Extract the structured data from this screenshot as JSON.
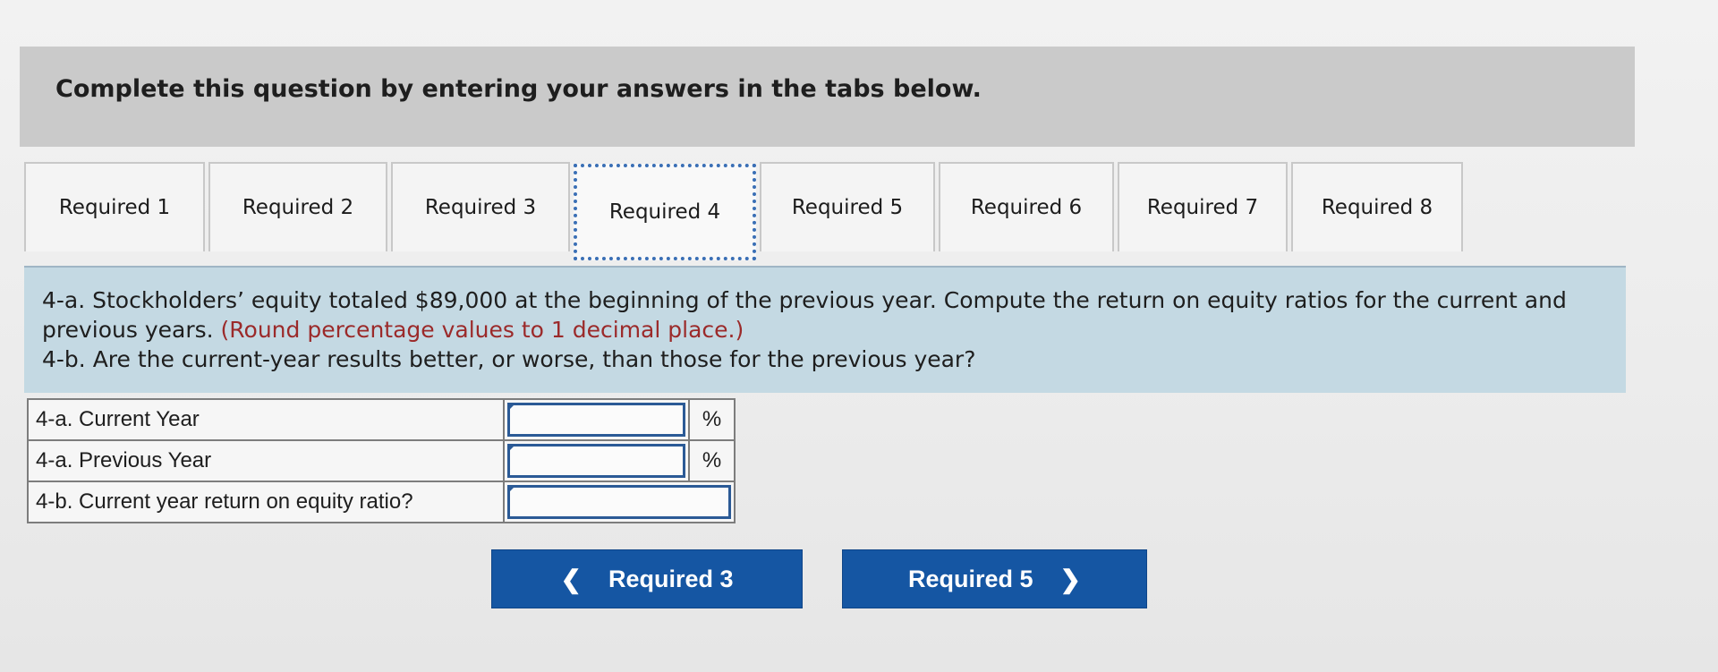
{
  "banner": {
    "text": "Complete this question by entering your answers in the tabs below."
  },
  "tabs": [
    {
      "label": "Required 1",
      "active": false
    },
    {
      "label": "Required 2",
      "active": false
    },
    {
      "label": "Required 3",
      "active": false
    },
    {
      "label": "Required 4",
      "active": true
    },
    {
      "label": "Required 5",
      "active": false
    },
    {
      "label": "Required 6",
      "active": false
    },
    {
      "label": "Required 7",
      "active": false
    },
    {
      "label": "Required 8",
      "active": false
    }
  ],
  "instructions": {
    "line1": "4-a. Stockholders’ equity totaled $89,000 at the beginning of the previous year. Compute the return on equity ratios for the current and previous years.",
    "note": "(Round percentage values to 1 decimal place.)",
    "line2": "4-b. Are the current-year results better, or worse, than those for the previous year?"
  },
  "table": {
    "rows": [
      {
        "label": "4-a. Current Year",
        "value": "",
        "unit": "%"
      },
      {
        "label": "4-a. Previous Year",
        "value": "",
        "unit": "%"
      },
      {
        "label": "4-b. Current year return on equity ratio?",
        "value": ""
      }
    ]
  },
  "nav": {
    "prev_label": "Required 3",
    "next_label": "Required 5",
    "prev_icon": "chevron-left-icon",
    "next_icon": "chevron-right-icon"
  },
  "colors": {
    "banner_bg": "#cacaca",
    "instructions_bg": "#c4d9e3",
    "note_text": "#9b2a2a",
    "button_bg": "#1556a3",
    "field_border": "#2b5a96"
  }
}
